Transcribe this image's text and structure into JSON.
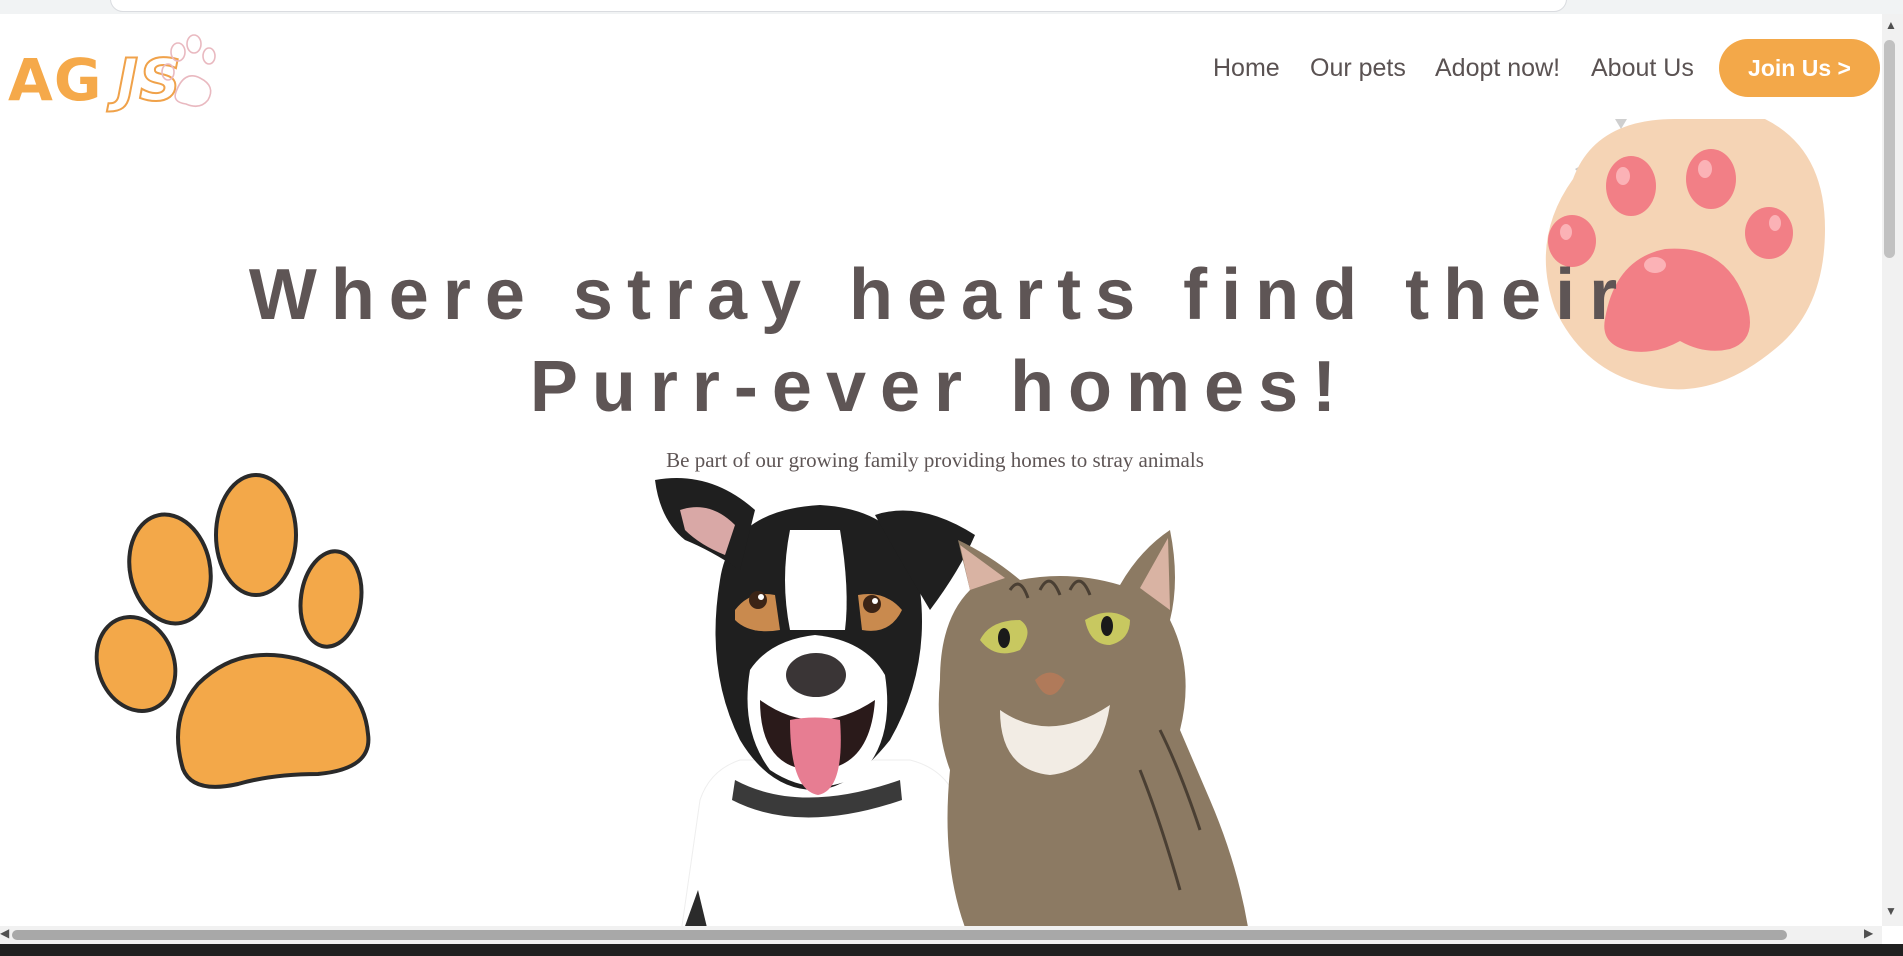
{
  "brand": {
    "logo_part1": "AG",
    "logo_part2": "JS"
  },
  "nav": {
    "items": [
      {
        "label": "Home"
      },
      {
        "label": "Our pets"
      },
      {
        "label": "Adopt now!"
      },
      {
        "label": "About Us"
      }
    ],
    "cta_label": "Join Us >"
  },
  "hero": {
    "headline_line1": "Where stray hearts find their",
    "headline_line2": "Purr-ever homes!",
    "subtitle": "Be part of our growing family providing homes to stray animals"
  },
  "colors": {
    "accent": "#f3a849",
    "text": "#5e5555",
    "paw_pink_pad": "#f5d4b5",
    "paw_pink_toe": "#f27f86"
  }
}
